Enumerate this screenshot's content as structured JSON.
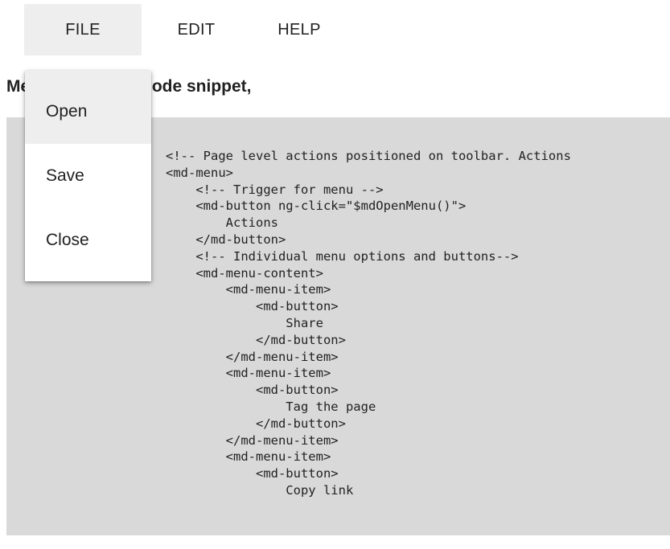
{
  "menubar": {
    "items": [
      {
        "label": "FILE"
      },
      {
        "label": "EDIT"
      },
      {
        "label": "HELP"
      }
    ]
  },
  "heading": "Menu in toolbar- code snippet,",
  "dropdown": {
    "items": [
      {
        "label": "Open"
      },
      {
        "label": "Save"
      },
      {
        "label": "Close"
      }
    ]
  },
  "code": "<!-- Page level actions positioned on toolbar. Actions\n<md-menu>\n    <!-- Trigger for menu -->\n    <md-button ng-click=\"$mdOpenMenu()\">\n        Actions\n    </md-button>\n    <!-- Individual menu options and buttons-->\n    <md-menu-content>\n        <md-menu-item>\n            <md-button>\n                Share\n            </md-button>\n        </md-menu-item>\n        <md-menu-item>\n            <md-button>\n                Tag the page\n            </md-button>\n        </md-menu-item>\n        <md-menu-item>\n            <md-button>\n                Copy link"
}
